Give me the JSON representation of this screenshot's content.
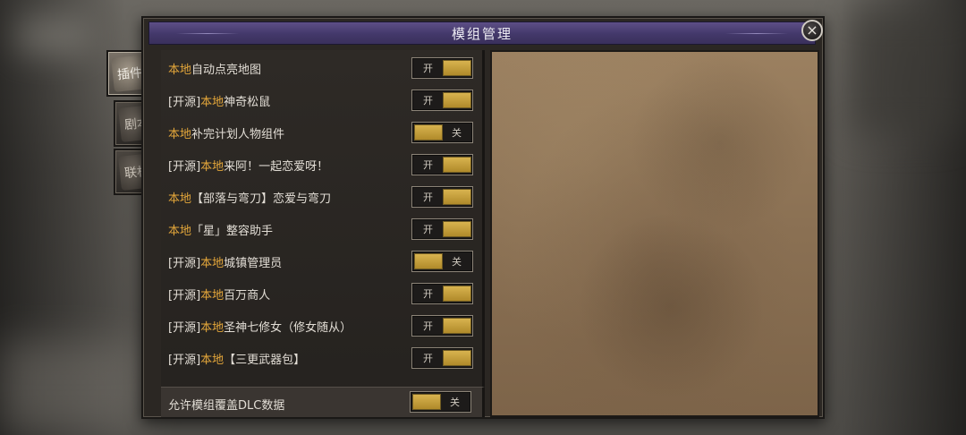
{
  "dialog": {
    "title": "模组管理",
    "close_label": "×"
  },
  "tabs": [
    {
      "label": "插件",
      "active": true
    },
    {
      "label": "剧本",
      "active": false
    },
    {
      "label": "联机",
      "active": false
    }
  ],
  "mods": [
    {
      "prefix": "",
      "tag": "本地",
      "name": "自动点亮地图",
      "state": "on",
      "state_label": "开"
    },
    {
      "prefix": "[开源]",
      "tag": "本地",
      "name": "神奇松鼠",
      "state": "on",
      "state_label": "开"
    },
    {
      "prefix": "",
      "tag": "本地",
      "name": "补完计划人物组件",
      "state": "off",
      "state_label": "关"
    },
    {
      "prefix": "[开源]",
      "tag": "本地",
      "name": "来阿！一起恋爱呀！",
      "state": "on",
      "state_label": "开"
    },
    {
      "prefix": "",
      "tag": "本地",
      "name": "【部落与弯刀】恋爱与弯刀",
      "state": "on",
      "state_label": "开"
    },
    {
      "prefix": "",
      "tag": "本地",
      "name": "「星」整容助手",
      "state": "on",
      "state_label": "开"
    },
    {
      "prefix": "[开源]",
      "tag": "本地",
      "name": "城镇管理员",
      "state": "off",
      "state_label": "关"
    },
    {
      "prefix": "[开源]",
      "tag": "本地",
      "name": "百万商人",
      "state": "on",
      "state_label": "开"
    },
    {
      "prefix": "[开源]",
      "tag": "本地",
      "name": "圣神七修女（修女随从）",
      "state": "on",
      "state_label": "开"
    },
    {
      "prefix": "[开源]",
      "tag": "本地",
      "name": "【三更武器包】",
      "state": "on",
      "state_label": "开"
    }
  ],
  "dlc_override": {
    "label": "允许模组覆盖DLC数据",
    "state": "off",
    "state_label": "关"
  },
  "colors": {
    "highlight": "#e3a63a",
    "titlebar": "#43386a",
    "toggle_knob": "#c9a23d"
  }
}
